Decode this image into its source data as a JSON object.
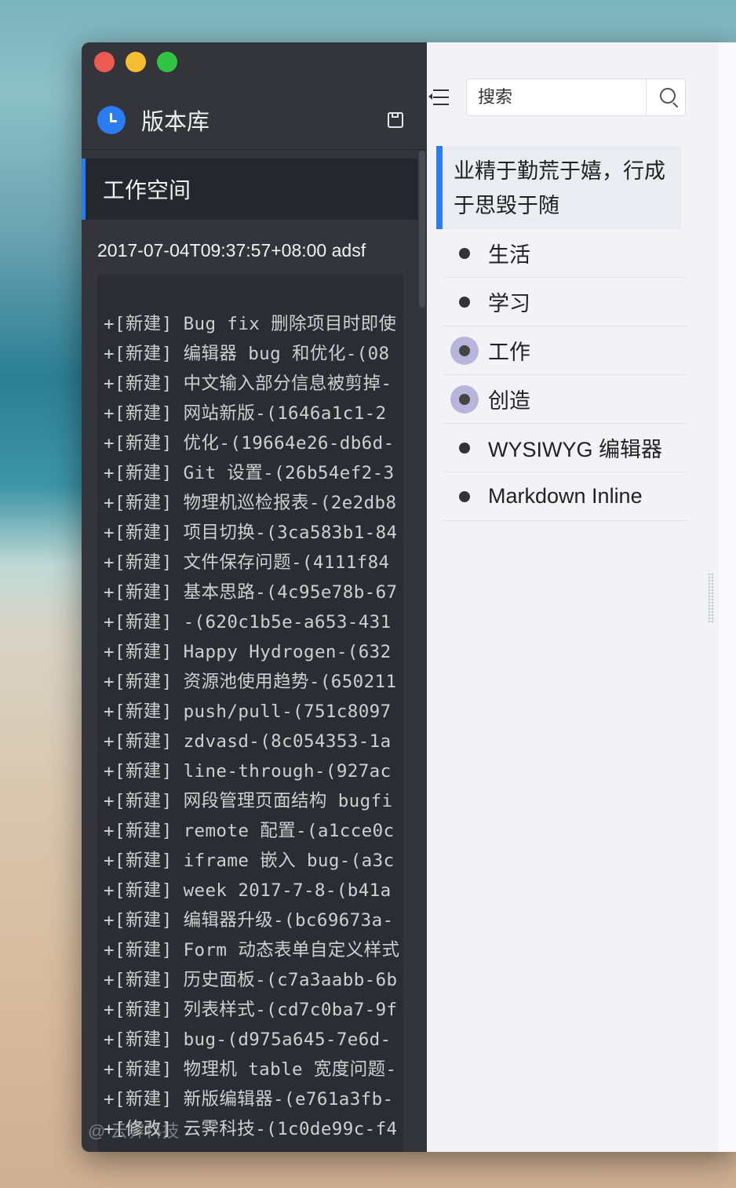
{
  "repo": {
    "title": "版本库"
  },
  "workspace": {
    "tab_label": "工作空间"
  },
  "commit": {
    "timestamp": "2017-07-04T09:37:57+08:00 adsf"
  },
  "log": [
    "+[新建] Bug fix 删除项目时即使",
    "+[新建] 编辑器 bug 和优化-(08",
    "+[新建] 中文输入部分信息被剪掉-",
    "+[新建] 网站新版-(1646a1c1-2",
    "+[新建] 优化-(19664e26-db6d-",
    "+[新建] Git 设置-(26b54ef2-3",
    "+[新建] 物理机巡检报表-(2e2db8",
    "+[新建] 项目切换-(3ca583b1-84",
    "+[新建] 文件保存问题-(4111f84",
    "+[新建] 基本思路-(4c95e78b-67",
    "+[新建] -(620c1b5e-a653-431",
    "+[新建] Happy Hydrogen-(632",
    "+[新建] 资源池使用趋势-(650211",
    "+[新建] push/pull-(751c8097",
    "+[新建] zdvasd-(8c054353-1a",
    "+[新建] line-through-(927ac",
    "+[新建] 网段管理页面结构 bugfi",
    "+[新建] remote 配置-(a1cce0c",
    "+[新建] iframe 嵌入 bug-(a3c",
    "+[新建] week 2017-7-8-(b41a",
    "+[新建] 编辑器升级-(bc69673a-",
    "+[新建] Form 动态表单自定义样式",
    "+[新建] 历史面板-(c7a3aabb-6b",
    "+[新建] 列表样式-(cd7c0ba7-9f",
    "+[新建] bug-(d975a645-7e6d-",
    "+[新建] 物理机 table 宽度问题-",
    "+[新建] 新版编辑器-(e761a3fb-",
    "+[修改] 云霁科技-(1c0de99c-f4"
  ],
  "watermark": {
    "text": "@ 云霁科技"
  },
  "search": {
    "placeholder": "搜索"
  },
  "motto": "业精于勤荒于嬉，行成于思毁于随",
  "nav": [
    {
      "label": "生活",
      "active": false
    },
    {
      "label": "学习",
      "active": false
    },
    {
      "label": "工作",
      "active": true
    },
    {
      "label": "创造",
      "active": true
    },
    {
      "label": "WYSIWYG 编辑器",
      "active": false
    },
    {
      "label": "Markdown Inline",
      "active": false
    }
  ],
  "colors": {
    "accent": "#2b7cf0",
    "sidebar_bg": "#34353b",
    "active_bullet": "#b8b4db"
  }
}
